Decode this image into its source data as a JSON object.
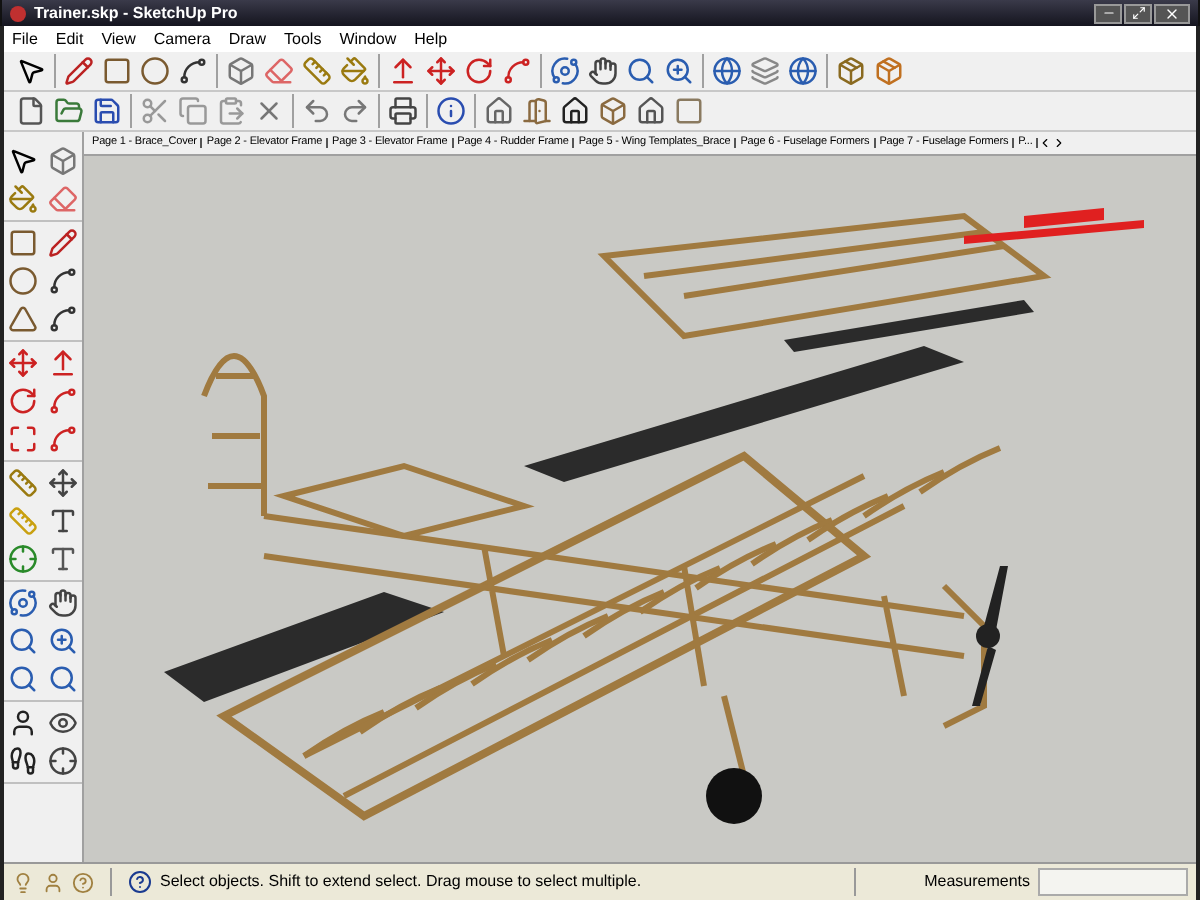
{
  "window": {
    "title": "Trainer.skp - SketchUp Pro"
  },
  "menu": [
    "File",
    "Edit",
    "View",
    "Camera",
    "Draw",
    "Tools",
    "Window",
    "Help"
  ],
  "tabs": [
    {
      "label": "Page 1 - Brace_Cover",
      "selected": false
    },
    {
      "label": "Page 2 - Elevator Frame",
      "selected": false
    },
    {
      "label": "Page 3 - Elevator Frame",
      "selected": false
    },
    {
      "label": "Page 4 - Rudder Frame",
      "selected": false
    },
    {
      "label": "Page 5 - Wing Templates_Brace",
      "selected": false
    },
    {
      "label": "Page 6 - Fuselage Formers",
      "selected": false
    },
    {
      "label": "Page 7 - Fuselage Formers",
      "selected": false
    },
    {
      "label": "P...",
      "selected": false
    }
  ],
  "status_bar": {
    "hint": "Select objects. Shift to extend select. Drag mouse to select multiple.",
    "measurements_label": "Measurements"
  }
}
